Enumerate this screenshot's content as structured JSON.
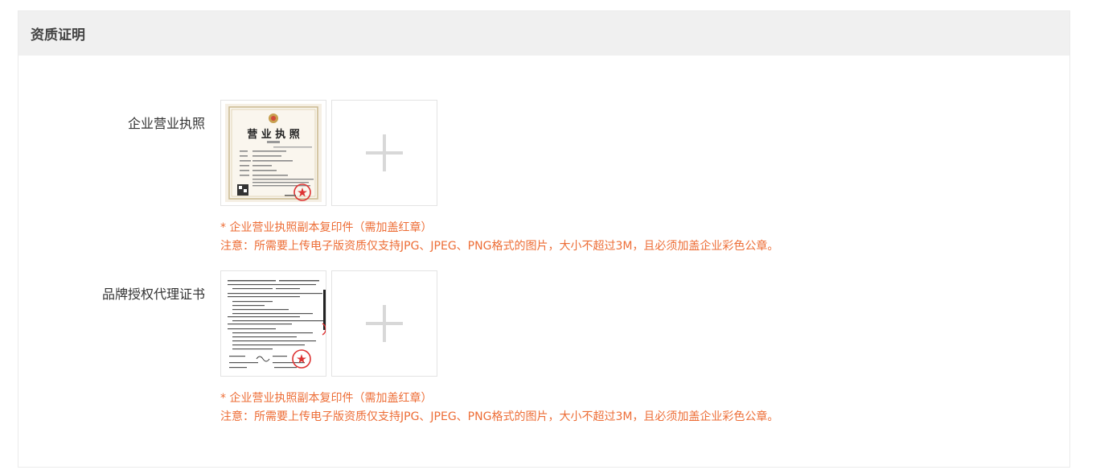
{
  "section": {
    "title": "资质证明"
  },
  "rows": [
    {
      "label": "企业营业执照",
      "image_icon": "business-license-image",
      "upload_icon": "plus-icon",
      "hint": "* 企业营业执照副本复印件（需加盖红章）",
      "notice": "注意：所需要上传电子版资质仅支持JPG、JPEG、PNG格式的图片，大小不超过3M，且必须加盖企业彩色公章。",
      "license_title": "营 业 执 照"
    },
    {
      "label": "品牌授权代理证书",
      "image_icon": "authorization-letter-image",
      "upload_icon": "plus-icon",
      "hint": "* 企业营业执照副本复印件（需加盖红章）",
      "notice": "注意：所需要上传电子版资质仅支持JPG、JPEG、PNG格式的图片，大小不超过3M，且必须加盖企业彩色公章。"
    }
  ],
  "colors": {
    "hint": "#ed6d36",
    "header_bg": "#f0f0f0",
    "border": "#ebebeb"
  }
}
